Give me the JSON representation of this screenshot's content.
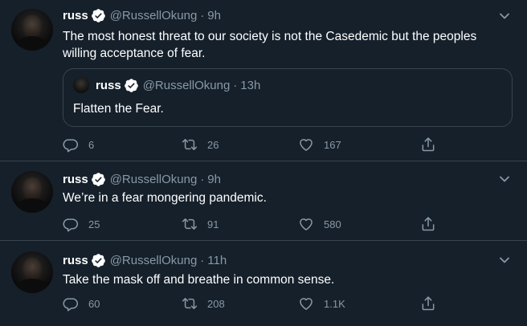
{
  "tweets": [
    {
      "name": "russ",
      "handle": "@RussellOkung",
      "separator": "·",
      "time": "9h",
      "text": "The most honest threat to our society is not the Casedemic but the peoples willing acceptance of fear.",
      "quote": {
        "name": "russ",
        "handle": "@RussellOkung",
        "separator": "·",
        "time": "13h",
        "text": "Flatten the Fear."
      },
      "replies": "6",
      "retweets": "26",
      "likes": "167"
    },
    {
      "name": "russ",
      "handle": "@RussellOkung",
      "separator": "·",
      "time": "9h",
      "text": "We’re in a fear mongering pandemic.",
      "replies": "25",
      "retweets": "91",
      "likes": "580"
    },
    {
      "name": "russ",
      "handle": "@RussellOkung",
      "separator": "·",
      "time": "11h",
      "text": "Take the mask off and breathe in common sense.",
      "replies": "60",
      "retweets": "208",
      "likes": "1.1K"
    }
  ],
  "icons": {
    "verified": "verified-badge-icon",
    "more": "chevron-down-icon",
    "reply": "reply-icon",
    "retweet": "retweet-icon",
    "like": "heart-icon",
    "share": "share-icon"
  },
  "colors": {
    "background": "#15202b",
    "border": "#38444d",
    "secondary_text": "#8899a6",
    "verified": "#ffffff"
  }
}
